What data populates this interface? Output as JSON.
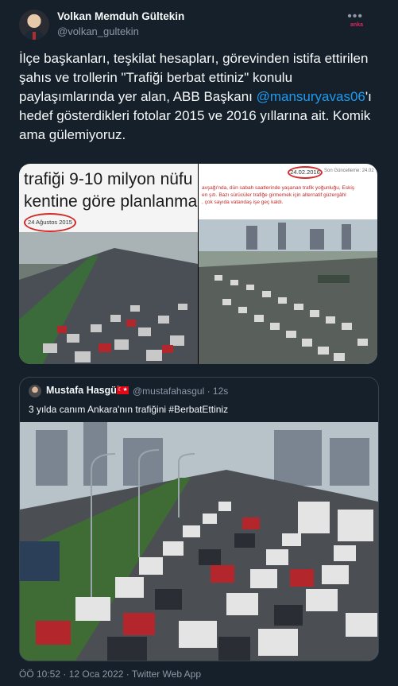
{
  "author": {
    "name": "Volkan Memduh Gültekin",
    "handle": "@volkan_gultekin",
    "more_label": "•••",
    "brand_label": "anka"
  },
  "tweet": {
    "text_part1": "İlçe başkanları, teşkilat hesapları, görevinden istifa ettirilen şahıs ve trollerin \"Trafiği berbat ettiniz\" konulu paylaşımlarında yer alan, ABB Başkanı ",
    "mention": "@mansuryavas06",
    "text_part2": "'ı hedef gösterdikleri fotolar 2015 ve 2016 yıllarına ait. Komik ama gülemiyoruz."
  },
  "photo1": {
    "headline_line1": "trafiği 9-10 milyon nüfu",
    "headline_line2": "kentine göre planlanma",
    "date": "24 Ağustos 2015"
  },
  "photo2": {
    "date": "24.02.2016",
    "meta": "Son Güncelleme: 24.02",
    "line1": "avşağı'nda, dün sabah saatlerinde yaşanan trafik yoğunluğu, Eskiş",
    "line2": "en şıtı. Bazı sürücüler trafiğe girmemek için alternatif güzergâhl",
    "line3": ", çok sayıda vatandaş işe geç kaldı."
  },
  "quoted": {
    "name": "Mustafa Hasgül",
    "flag": "☾★",
    "handle": "@mustafahasgul · 12s",
    "text": "3 yılda canım Ankara'nın trafiğini #BerbatEttiniz"
  },
  "footer": {
    "timestamp": "ÖÖ 10:52 · 12 Oca 2022 · Twitter Web App"
  }
}
